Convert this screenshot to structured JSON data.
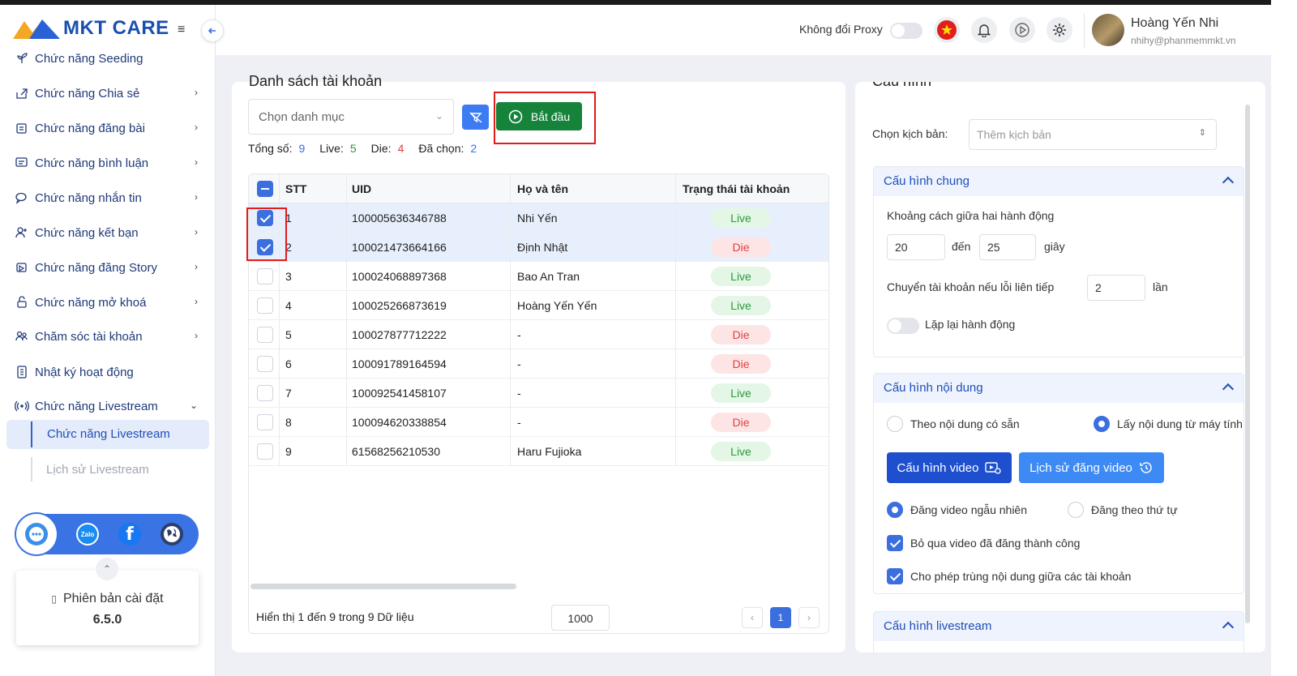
{
  "brand": {
    "name": "MKT CARE"
  },
  "sidebar": {
    "items": [
      {
        "label": "Chức năng Seeding",
        "icon": "seeding-icon",
        "chevron": false
      },
      {
        "label": "Chức năng Chia sẻ",
        "icon": "share-icon",
        "chevron": true
      },
      {
        "label": "Chức năng đăng bài",
        "icon": "post-icon",
        "chevron": true
      },
      {
        "label": "Chức năng bình luận",
        "icon": "comment-icon",
        "chevron": true
      },
      {
        "label": "Chức năng nhắn tin",
        "icon": "message-icon",
        "chevron": true
      },
      {
        "label": "Chức năng kết bạn",
        "icon": "add-friend-icon",
        "chevron": true
      },
      {
        "label": "Chức năng đăng Story",
        "icon": "story-icon",
        "chevron": true
      },
      {
        "label": "Chức năng mở khoá",
        "icon": "unlock-icon",
        "chevron": true
      },
      {
        "label": "Chăm sóc tài khoản",
        "icon": "account-care-icon",
        "chevron": true
      },
      {
        "label": "Nhật ký hoạt động",
        "icon": "log-icon",
        "chevron": false
      },
      {
        "label": "Chức năng Livestream",
        "icon": "livestream-icon",
        "chevron": true
      }
    ],
    "sub_active": "Chức năng Livestream",
    "sub_other": "Lịch sử Livestream",
    "social": {
      "zalo": "Zalo"
    },
    "version_label": "Phiên bản cài đặt",
    "version": "6.5.0"
  },
  "topbar": {
    "proxy_label": "Không đổi Proxy",
    "user_name": "Hoàng Yến Nhi",
    "user_email": "nhihy@phanmemmkt.vn"
  },
  "accounts": {
    "title": "Danh sách tài khoản",
    "category_placeholder": "Chọn danh mục",
    "start_label": "Bắt đầu",
    "stats": {
      "total_label": "Tổng số:",
      "total": "9",
      "live_label": "Live:",
      "live": "5",
      "die_label": "Die:",
      "die": "4",
      "selected_label": "Đã chọn:",
      "selected": "2"
    },
    "columns": [
      "STT",
      "UID",
      "Họ và tên",
      "Trạng thái tài khoản"
    ],
    "rows": [
      {
        "stt": "1",
        "uid": "100005636346788",
        "name": "Nhi Yến",
        "status": "Live",
        "checked": true
      },
      {
        "stt": "2",
        "uid": "100021473664166",
        "name": "Định Nhật",
        "status": "Die",
        "checked": true
      },
      {
        "stt": "3",
        "uid": "100024068897368",
        "name": "Bao An Tran",
        "status": "Live",
        "checked": false
      },
      {
        "stt": "4",
        "uid": "100025266873619",
        "name": "Hoàng Yến Yến",
        "status": "Live",
        "checked": false
      },
      {
        "stt": "5",
        "uid": "100027877712222",
        "name": "-",
        "status": "Die",
        "checked": false
      },
      {
        "stt": "6",
        "uid": "100091789164594",
        "name": "-",
        "status": "Die",
        "checked": false
      },
      {
        "stt": "7",
        "uid": "100092541458107",
        "name": "-",
        "status": "Live",
        "checked": false
      },
      {
        "stt": "8",
        "uid": "100094620338854",
        "name": "-",
        "status": "Die",
        "checked": false
      },
      {
        "stt": "9",
        "uid": "61568256210530",
        "name": "Haru Fujioka",
        "status": "Live",
        "checked": false
      }
    ],
    "footer_text": "Hiển thị 1 đến 9 trong 9 Dữ liệu",
    "page_size": "1000",
    "current_page": "1",
    "prev": "‹",
    "next": "›"
  },
  "config": {
    "title": "Cấu hình",
    "script_label": "Chọn kịch bản:",
    "script_placeholder": "Thêm kịch bản",
    "general": {
      "title": "Cấu hình chung",
      "interval_label": "Khoảng cách giữa hai hành động",
      "from_value": "20",
      "to_label": "đến",
      "to_value": "25",
      "unit": "giây",
      "switch_label": "Chuyển tài khoản nếu lỗi liên tiếp",
      "switch_value": "2",
      "switch_unit": "lần",
      "repeat_label": "Lặp lại hành động"
    },
    "content": {
      "title": "Cấu hình nội dung",
      "opt_existing": "Theo nội dung có sẵn",
      "opt_machine": "Lấy nội dung từ máy tính",
      "video_config_btn": "Cấu hình video",
      "video_history_btn": "Lịch sử đăng video",
      "random_label": "Đăng video ngẫu nhiên",
      "order_label": "Đăng theo thứ tự",
      "skip_label": "Bỏ qua video đã đăng thành công",
      "dup_label": "Cho phép trùng nội dung giữa các tài khoản"
    },
    "livestream": {
      "title": "Cấu hình livestream"
    }
  },
  "colors": {
    "primary": "#3b6fe0",
    "start": "#16833a",
    "live": "#2c9a3c",
    "die": "#e04040",
    "highlight": "#e21b1b"
  }
}
